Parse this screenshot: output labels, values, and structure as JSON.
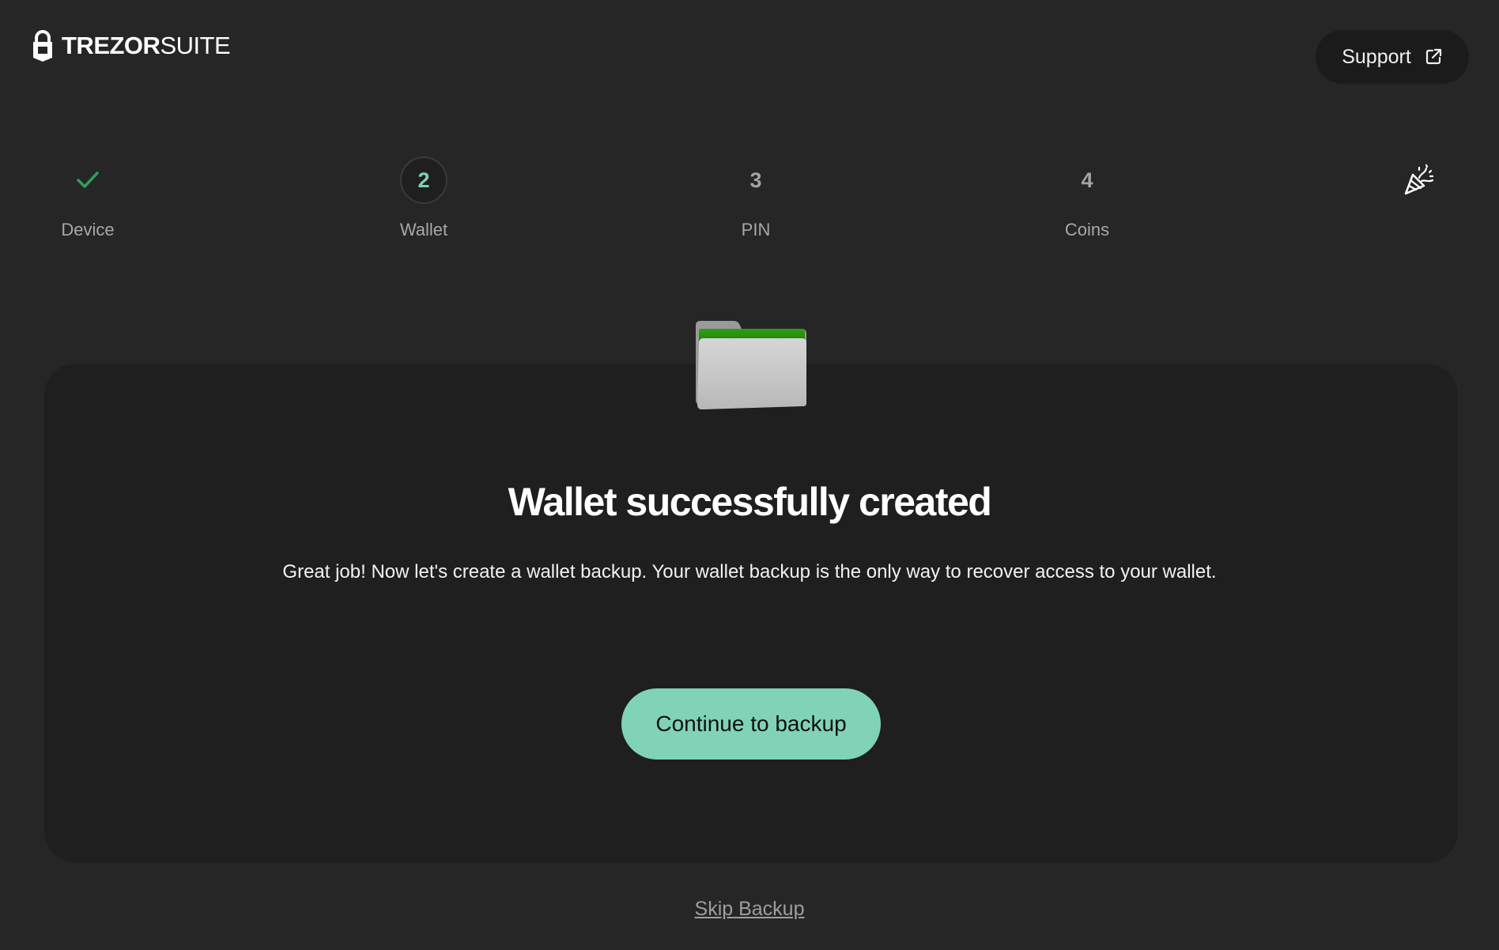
{
  "header": {
    "logo_bold": "TREZOR",
    "logo_light": "SUITE",
    "support_label": "Support"
  },
  "stepper": {
    "steps": [
      {
        "marker": "",
        "label": "Device",
        "state": "completed",
        "icon": "checkmark-icon"
      },
      {
        "marker": "2",
        "label": "Wallet",
        "state": "active"
      },
      {
        "marker": "3",
        "label": "PIN",
        "state": "upcoming"
      },
      {
        "marker": "4",
        "label": "Coins",
        "state": "upcoming"
      },
      {
        "marker": "",
        "label": "",
        "state": "upcoming",
        "icon": "party-popper-icon"
      }
    ]
  },
  "main": {
    "title": "Wallet successfully created",
    "description": "Great job! Now let's create a wallet backup. Your wallet backup is the only way to recover access to your wallet.",
    "cta_label": "Continue to backup",
    "skip_label": "Skip Backup"
  },
  "colors": {
    "background": "#262626",
    "card": "#1f1f1f",
    "accent": "#80d3b6",
    "check": "#2f9e5a"
  }
}
